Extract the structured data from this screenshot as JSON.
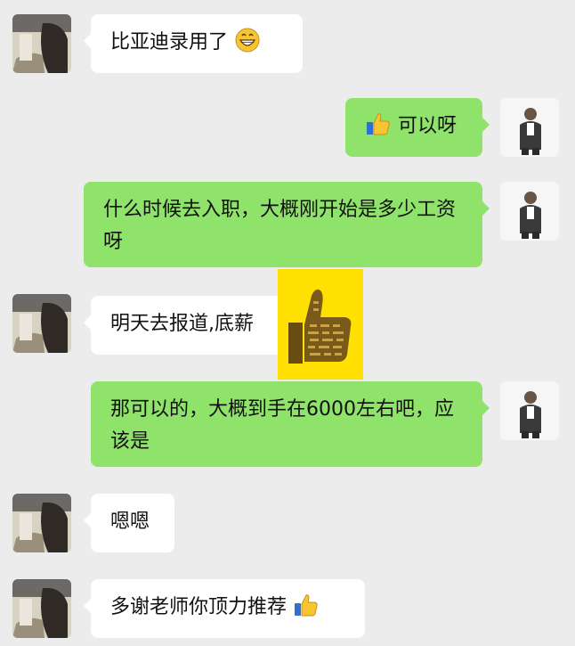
{
  "messages": [
    {
      "side": "left",
      "text": "比亚迪录用了",
      "emoji": "grinning-face-icon"
    },
    {
      "side": "right",
      "text": "可以呀",
      "emoji_prefix": "thumbs-up-icon"
    },
    {
      "side": "right",
      "text": "什么时候去入职，大概刚开始是多少工资呀"
    },
    {
      "side": "left",
      "text": "明天去报道,底薪"
    },
    {
      "side": "right",
      "text": "那可以的，大概到手在6000左右吧，应该是"
    },
    {
      "side": "left",
      "text": "嗯嗯"
    },
    {
      "side": "left",
      "text": "多谢老师你顶力推荐",
      "emoji": "thumbs-up-icon"
    }
  ],
  "sticker": {
    "icon": "thumbs-up-sticker-icon",
    "color": "#ffe000"
  },
  "colors": {
    "background": "#ececec",
    "sent_bubble": "#8fe36a",
    "received_bubble": "#ffffff"
  }
}
